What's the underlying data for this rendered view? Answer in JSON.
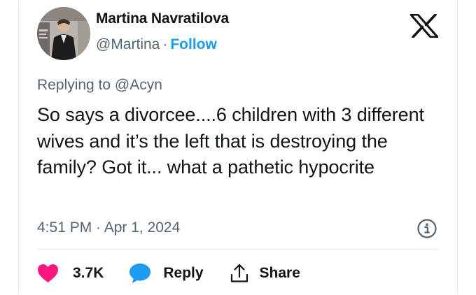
{
  "author": {
    "name": "Martina Navratilova",
    "handle": "@Martina",
    "separator": "·",
    "follow_label": "Follow",
    "avatar_icon": "profile-photo"
  },
  "platform": {
    "logo_icon": "x-logo"
  },
  "tweet": {
    "replying_to": "Replying to @Acyn",
    "text": "So says a divorcee....6 children with 3 different wives and it’s the left that is destroying the family? Got it... what a pathetic hypocrite",
    "timestamp": "4:51 PM · Apr 1, 2024",
    "info_icon": "info-icon"
  },
  "actions": {
    "like_icon": "heart-icon",
    "like_count": "3.7K",
    "reply_icon": "speech-bubble-icon",
    "reply_label": "Reply",
    "share_icon": "share-upload-icon",
    "share_label": "Share"
  },
  "colors": {
    "text": "#0f1419",
    "secondary": "#536471",
    "accent": "#1d9bf0",
    "like": "#f91880",
    "divider": "#e1e5e8"
  }
}
